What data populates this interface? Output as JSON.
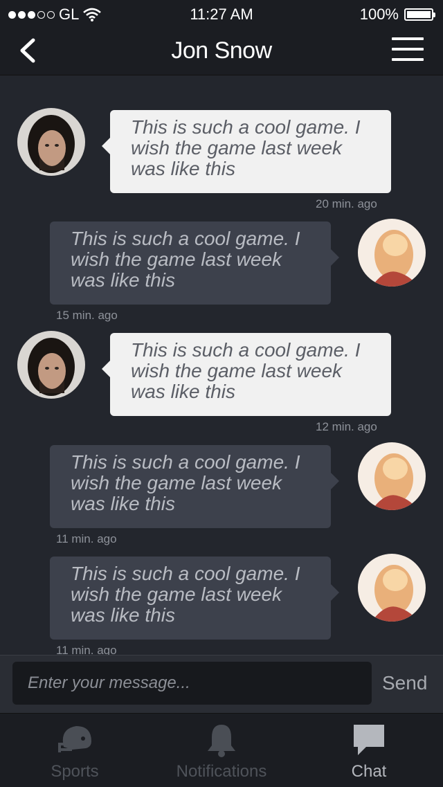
{
  "status_bar": {
    "carrier": "GL",
    "time": "11:27 AM",
    "battery": "100%"
  },
  "header": {
    "title": "Jon Snow"
  },
  "messages": [
    {
      "direction": "in",
      "text": "This is such a cool game. I wish the game last week was like this",
      "time": "20 min. ago"
    },
    {
      "direction": "out",
      "text": "This is such a cool game. I wish the game last week was like this",
      "time": "15 min. ago"
    },
    {
      "direction": "in",
      "text": "This is such a cool game. I wish the game last week was like this",
      "time": "12 min. ago"
    },
    {
      "direction": "out",
      "text": "This is such a cool game. I wish the game last week was like this",
      "time": "11 min. ago"
    },
    {
      "direction": "out",
      "text": "This is such a cool game. I wish the game last week was like this",
      "time": "11 min. ago"
    }
  ],
  "composer": {
    "placeholder": "Enter your message...",
    "value": "",
    "send_label": "Send"
  },
  "tabs": [
    {
      "label": "Sports",
      "icon": "football-helmet-icon",
      "active": false
    },
    {
      "label": "Notifications",
      "icon": "bell-icon",
      "active": false
    },
    {
      "label": "Chat",
      "icon": "chat-bubble-icon",
      "active": true
    }
  ],
  "colors": {
    "background": "#23262d",
    "bar": "#1b1d22",
    "incoming_bubble": "#f1f1f1",
    "outgoing_bubble": "#3d414c"
  }
}
